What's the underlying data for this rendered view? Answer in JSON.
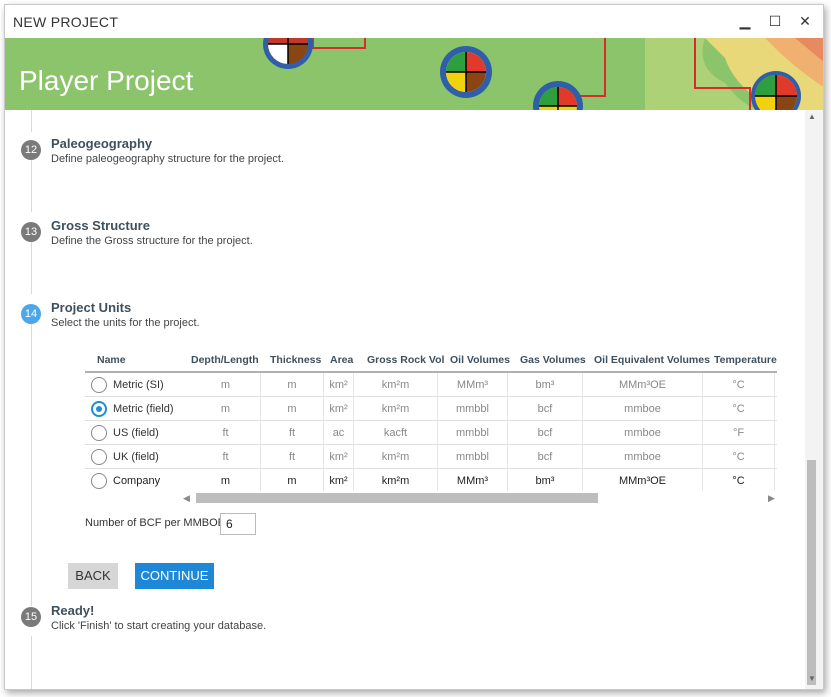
{
  "window": {
    "title": "NEW PROJECT",
    "minimize": "▁",
    "maximize": "☐",
    "close": "✕"
  },
  "banner": {
    "title": "Player Project"
  },
  "steps": [
    {
      "number": "12",
      "title": "Paleogeography",
      "desc": "Define paleogeography structure for the project."
    },
    {
      "number": "13",
      "title": "Gross Structure",
      "desc": "Define the Gross structure for the project."
    },
    {
      "number": "14",
      "title": "Project Units",
      "desc": "Select the units for the project."
    },
    {
      "number": "15",
      "title": "Ready!",
      "desc": "Click 'Finish' to start creating your database."
    }
  ],
  "units_table": {
    "headers": [
      "Name",
      "Depth/Length",
      "Thickness",
      "Area",
      "Gross Rock Vol",
      "Oil Volumes",
      "Gas Volumes",
      "Oil Equivalent Volumes",
      "Temperature"
    ],
    "rows": [
      {
        "name": "Metric (SI)",
        "selected": false,
        "cells": [
          "m",
          "m",
          "km²",
          "km²m",
          "MMm³",
          "bm³",
          "MMm³OE",
          "°C"
        ]
      },
      {
        "name": "Metric (field)",
        "selected": true,
        "cells": [
          "m",
          "m",
          "km²",
          "km²m",
          "mmbbl",
          "bcf",
          "mmboe",
          "°C"
        ]
      },
      {
        "name": "US (field)",
        "selected": false,
        "cells": [
          "ft",
          "ft",
          "ac",
          "kacft",
          "mmbbl",
          "bcf",
          "mmboe",
          "°F"
        ]
      },
      {
        "name": "UK (field)",
        "selected": false,
        "cells": [
          "ft",
          "ft",
          "km²",
          "km²m",
          "mmbbl",
          "bcf",
          "mmboe",
          "°C"
        ]
      },
      {
        "name": "Company",
        "selected": false,
        "cells": [
          "m",
          "m",
          "km²",
          "km²m",
          "MMm³",
          "bm³",
          "MMm³OE",
          "°C"
        ]
      }
    ]
  },
  "bcf": {
    "label": "Number of BCF per MMBOE",
    "value": "6"
  },
  "buttons": {
    "back": "BACK",
    "continue": "CONTINUE"
  },
  "colors": {
    "accent": "#1e88d8",
    "active_step": "#4aa8e8",
    "banner_green": "#8cc46c"
  }
}
